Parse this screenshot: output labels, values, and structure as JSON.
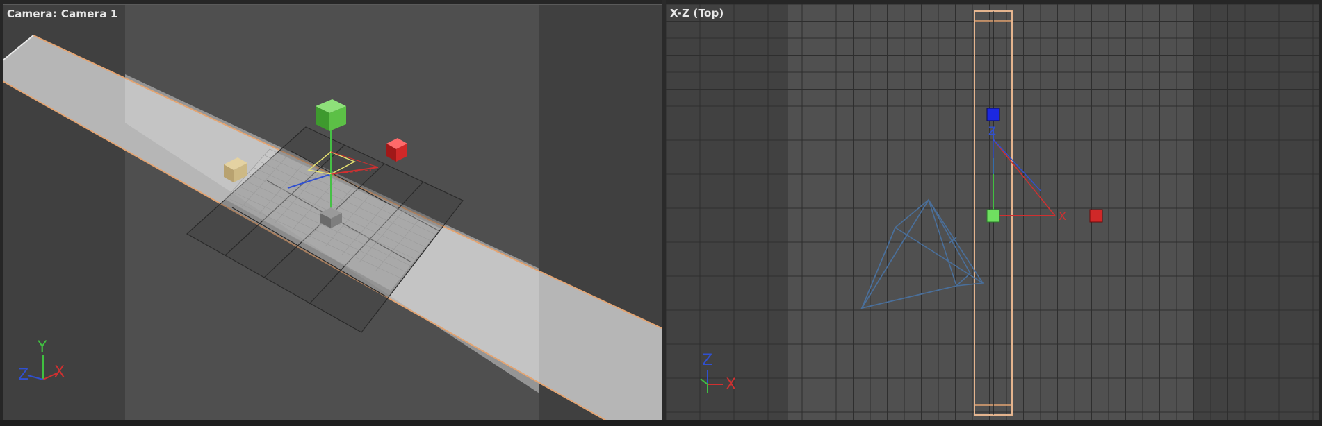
{
  "viewports": {
    "left": {
      "label": "Camera:",
      "name": "Camera 1"
    },
    "right": {
      "label": "X-Z (Top)"
    }
  },
  "axis_labels": {
    "x": "X",
    "y": "Y",
    "z": "Z"
  },
  "colors": {
    "selection_outline": "#e3a472",
    "active_border": "#4f86c8",
    "grid_line": "#2e2e2e",
    "road": "#bdbdbd",
    "x_axis": "#d03030",
    "y_axis": "#40c040",
    "z_axis": "#3050d0",
    "camera_wire": "#4a6f9a"
  },
  "icons": [
    "camera-frustum-icon",
    "axis-gizmo-icon",
    "move-gizmo-icon"
  ]
}
